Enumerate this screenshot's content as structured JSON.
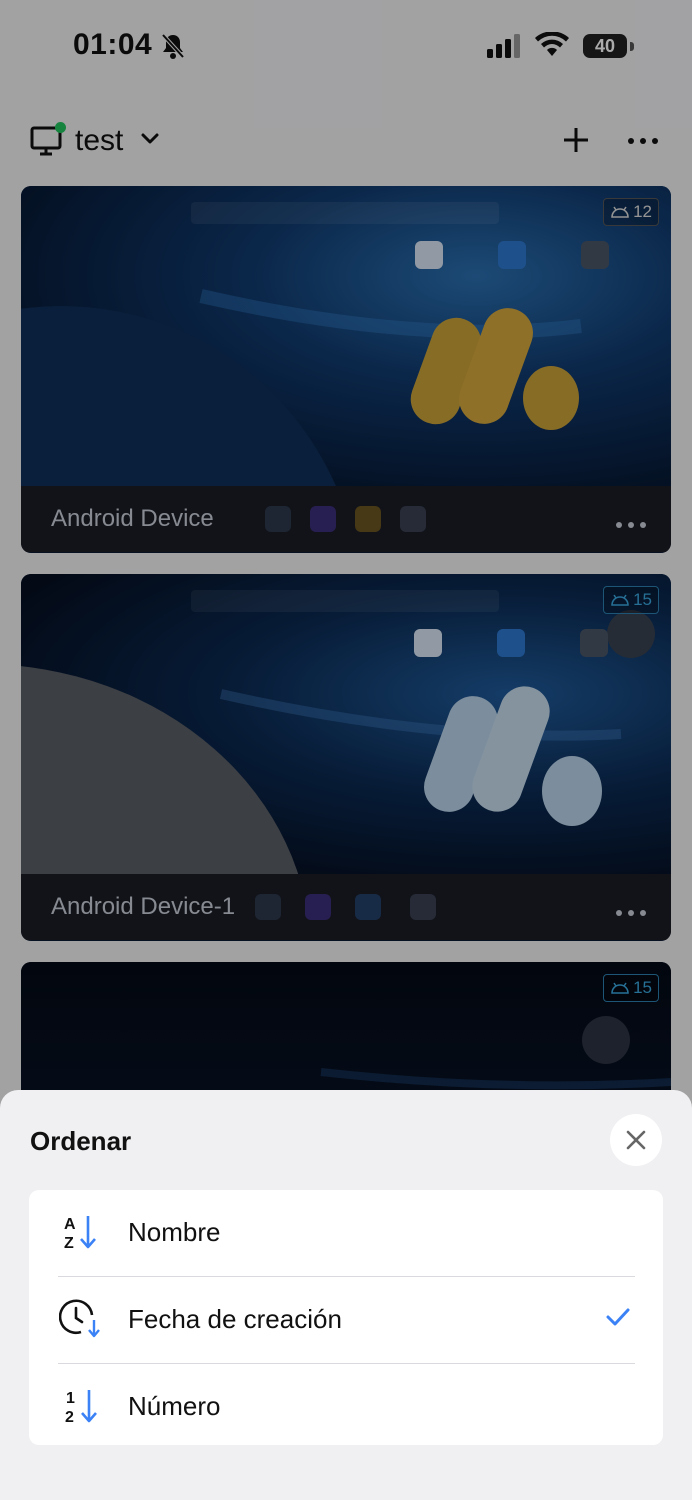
{
  "status_bar": {
    "time": "01:04",
    "battery": "40"
  },
  "header": {
    "workspace_name": "test"
  },
  "devices": [
    {
      "name": "Android Device",
      "android_version": "12"
    },
    {
      "name": "Android Device-1",
      "android_version": "15"
    },
    {
      "name": "",
      "android_version": "15"
    }
  ],
  "sort_sheet": {
    "title": "Ordenar",
    "options": [
      {
        "label": "Nombre",
        "icon": "sort-az-icon"
      },
      {
        "label": "Fecha de creación",
        "icon": "clock-sort-icon",
        "selected": true
      },
      {
        "label": "Número",
        "icon": "sort-12-icon"
      }
    ]
  },
  "colors": {
    "accent": "#3b82f6",
    "online": "#22c55e"
  }
}
